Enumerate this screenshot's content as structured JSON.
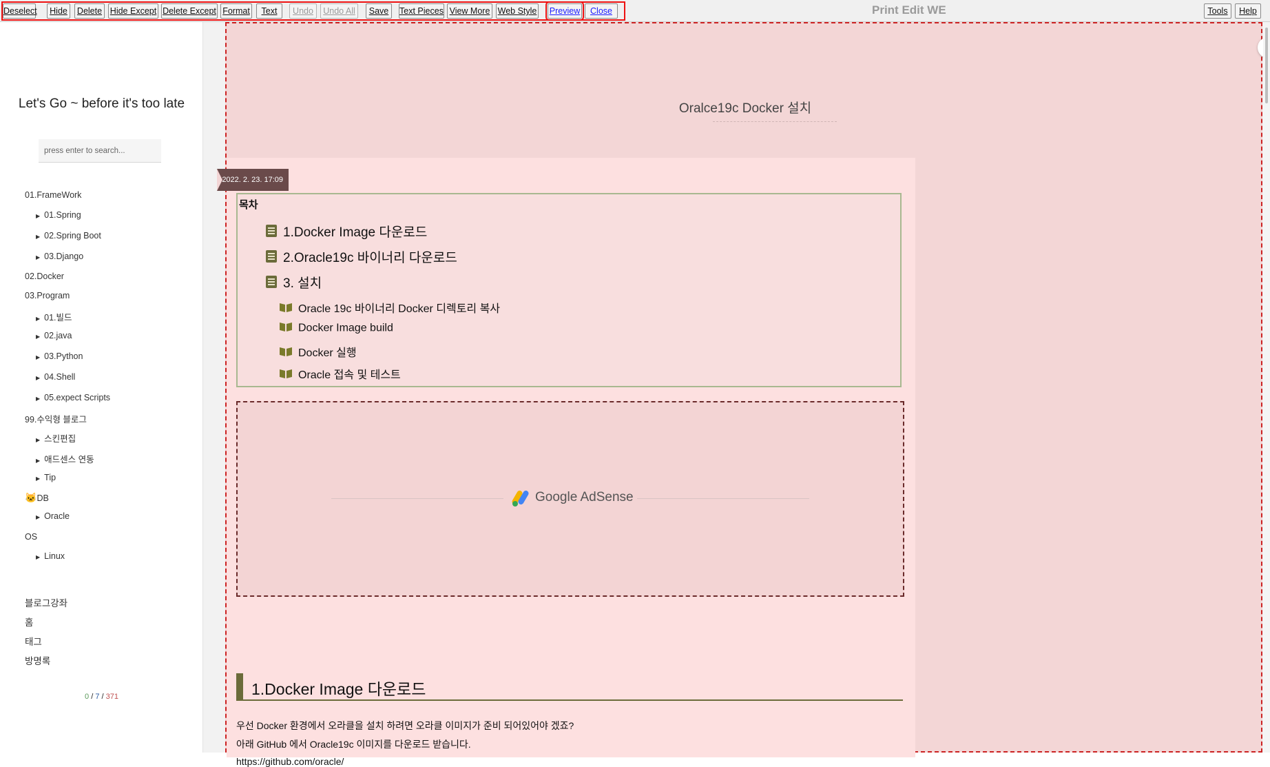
{
  "toolbar": {
    "buttons": [
      {
        "label": "Deselect"
      },
      {
        "label": "Hide"
      },
      {
        "label": "Delete"
      },
      {
        "label": "Hide Except"
      },
      {
        "label": "Delete Except"
      },
      {
        "label": "Format"
      },
      {
        "label": "Text"
      },
      {
        "label": "Undo"
      },
      {
        "label": "Undo All"
      },
      {
        "label": "Save"
      },
      {
        "label": "Text Pieces"
      },
      {
        "label": "View More"
      },
      {
        "label": "Web Style"
      },
      {
        "label": "Preview"
      },
      {
        "label": "Close"
      },
      {
        "label": "Tools"
      },
      {
        "label": "Help"
      }
    ],
    "app_title": "Print Edit WE",
    "highlight_color": "#ee1111"
  },
  "sidebar": {
    "blog_title": "Let's Go ~ before it's too late",
    "search_placeholder": "press enter to search...",
    "categories": [
      {
        "label": "01.FrameWork"
      },
      {
        "label": "01.Spring"
      },
      {
        "label": "02.Spring Boot"
      },
      {
        "label": "03.Django"
      },
      {
        "label": "02.Docker"
      },
      {
        "label": "03.Program"
      },
      {
        "label": "01.빌드"
      },
      {
        "label": "02.java"
      },
      {
        "label": "03.Python"
      },
      {
        "label": "04.Shell"
      },
      {
        "label": "05.expect Scripts"
      },
      {
        "label": "99.수익형 블로그"
      },
      {
        "label": "스킨편집"
      },
      {
        "label": "애드센스 연동"
      },
      {
        "label": "Tip"
      },
      {
        "label": "DB"
      },
      {
        "label": "Oracle"
      },
      {
        "label": "OS"
      },
      {
        "label": "Linux"
      }
    ],
    "links": [
      {
        "label": "블로그강좌"
      },
      {
        "label": "홈"
      },
      {
        "label": "태그"
      },
      {
        "label": "방명록"
      }
    ],
    "counter": {
      "today": "0",
      "yesterday": "7",
      "total": "371"
    }
  },
  "post": {
    "title": "Oralce19c Docker 설치",
    "date": "2022. 2. 23. 17:09",
    "toc": {
      "header": "목차",
      "items": [
        {
          "label": "1.Docker Image 다운로드"
        },
        {
          "label": "2.Oracle19c 바이너리 다운로드"
        },
        {
          "label": "3. 설치"
        },
        {
          "label": "Oracle 19c 바이너리 Docker 디렉토리 복사"
        },
        {
          "label": "Docker Image build"
        },
        {
          "label": "Docker 실행"
        },
        {
          "label": "Oracle 접속 및 테스트"
        }
      ]
    },
    "ad": {
      "label": "Google AdSense"
    },
    "section1": {
      "heading": "1.Docker Image 다운로드",
      "paragraphs": [
        "우선 Docker 환경에서 오라클을 설치 하려면 오라클 이미지가 준비 되어있어야 겠죠?",
        "아래 GitHub 에서 Oracle19c 이미지를 다운로드 받습니다.",
        "https://github.com/oracle/"
      ]
    }
  },
  "colors": {
    "preview_bg": "#f3d6d6",
    "card_bg": "#fde0e0",
    "dashed_border": "#cc2222",
    "accent_olive": "#6b6b3a"
  }
}
